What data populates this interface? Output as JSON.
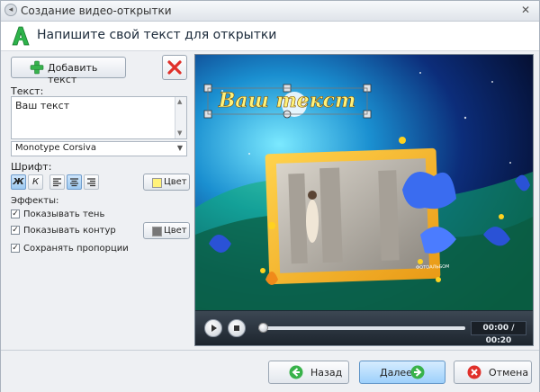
{
  "window": {
    "title": "Создание видео-открытки"
  },
  "header": {
    "heading": "Напишите свой текст для открытки"
  },
  "toolbar": {
    "add_text_label": "Добавить текст"
  },
  "text_section": {
    "label": "Текст:",
    "value": "Ваш текст",
    "font_value": "Monotype Corsiva"
  },
  "font_section": {
    "label": "Шрифт:",
    "bold_label": "Ж",
    "italic_label": "К",
    "color_label": "Цвет",
    "text_color": "#fff27a"
  },
  "effects": {
    "label": "Эффекты:",
    "shadow_label": "Показывать тень",
    "shadow_checked": true,
    "outline_label": "Показывать контур",
    "outline_checked": true,
    "outline_color_label": "Цвет",
    "outline_color": "#777777",
    "proportions_label": "Сохранять пропорции",
    "proportions_checked": true
  },
  "preview": {
    "overlay_text": "Ваш текст",
    "photo_caption": "ФОТОАЛЬБОМ",
    "timecode": "00:00 / 00:20",
    "progress": 0
  },
  "footer": {
    "back_label": "Назад",
    "next_label": "Далее",
    "cancel_label": "Отмена"
  }
}
